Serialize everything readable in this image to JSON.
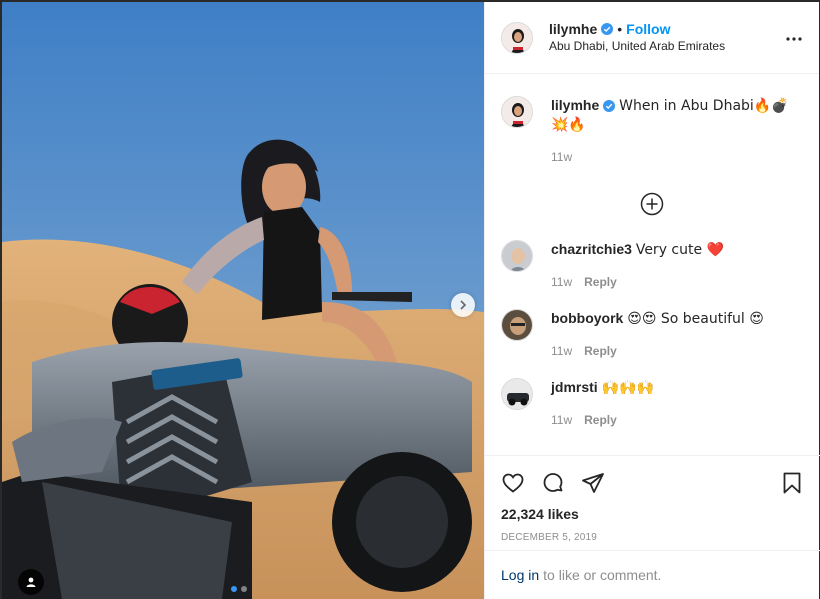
{
  "post": {
    "username": "lilymhe",
    "separator": "•",
    "follow_label": "Follow",
    "location": "Abu Dhabi, United Arab Emirates",
    "icons": {
      "verified": "verified-badge-icon",
      "more": "more-options-icon",
      "next": "chevron-right-icon",
      "tag": "user-tag-icon"
    }
  },
  "caption": {
    "username": "lilymhe",
    "text": "When in Abu Dhabi🔥💣💥🔥",
    "time": "11w"
  },
  "load_more_icon": "plus-circle-icon",
  "comments": [
    {
      "username": "chazritchie3",
      "text": "Very cute ❤️",
      "time": "11w",
      "reply": "Reply"
    },
    {
      "username": "bobboyork",
      "text": "😍😍 So beautiful 😍",
      "time": "11w",
      "reply": "Reply"
    },
    {
      "username": "jdmrsti",
      "text": "🙌🙌🙌",
      "time": "11w",
      "reply": "Reply"
    }
  ],
  "actions": {
    "icons": [
      "heart-icon",
      "comment-icon",
      "share-icon",
      "bookmark-icon"
    ],
    "likes": "22,324 likes",
    "date": "DECEMBER 5, 2019"
  },
  "login": {
    "link": "Log in",
    "text": "to like or comment."
  },
  "carousel": {
    "total": 2,
    "current": 1
  },
  "colors": {
    "accent": "#0095f6",
    "verified": "#3897f0",
    "muted": "#8e8e8e",
    "heart": "#ed4956"
  }
}
